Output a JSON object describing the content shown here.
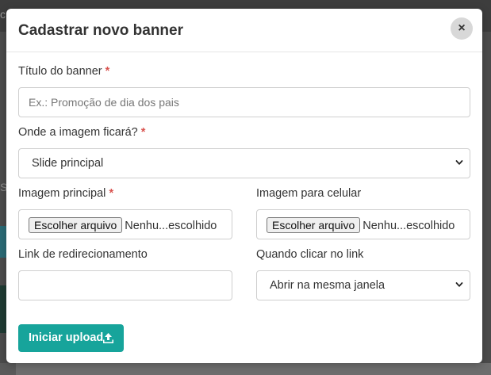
{
  "modal": {
    "title": "Cadastrar novo banner",
    "close_label": "×"
  },
  "form": {
    "title_label": "Título do banner",
    "title_placeholder": "Ex.: Promoção de dia dos pais",
    "title_value": "",
    "location_label": "Onde a imagem ficará?",
    "location_selected": "Slide principal",
    "main_image_label": "Imagem principal",
    "main_image_button": "Escolher arquivo",
    "main_image_status": "Nenhu...escolhido",
    "mobile_image_label": "Imagem para celular",
    "mobile_image_button": "Escolher arquivo",
    "mobile_image_status": "Nenhu...escolhido",
    "link_label": "Link de redirecionamento",
    "link_value": "",
    "click_label": "Quando clicar no link",
    "click_selected": "Abrir na mesma janela",
    "required_mark": "*",
    "submit_label": "Iniciar upload"
  },
  "backdrop": {
    "top_left_text": "c",
    "mid_left_text": "SC"
  },
  "colors": {
    "accent": "#17a49b",
    "required": "#d9534f",
    "overlay": "#4b4b4b"
  },
  "icons": {
    "close": "close-icon",
    "chevron": "chevron-down-icon",
    "upload": "upload-icon"
  }
}
